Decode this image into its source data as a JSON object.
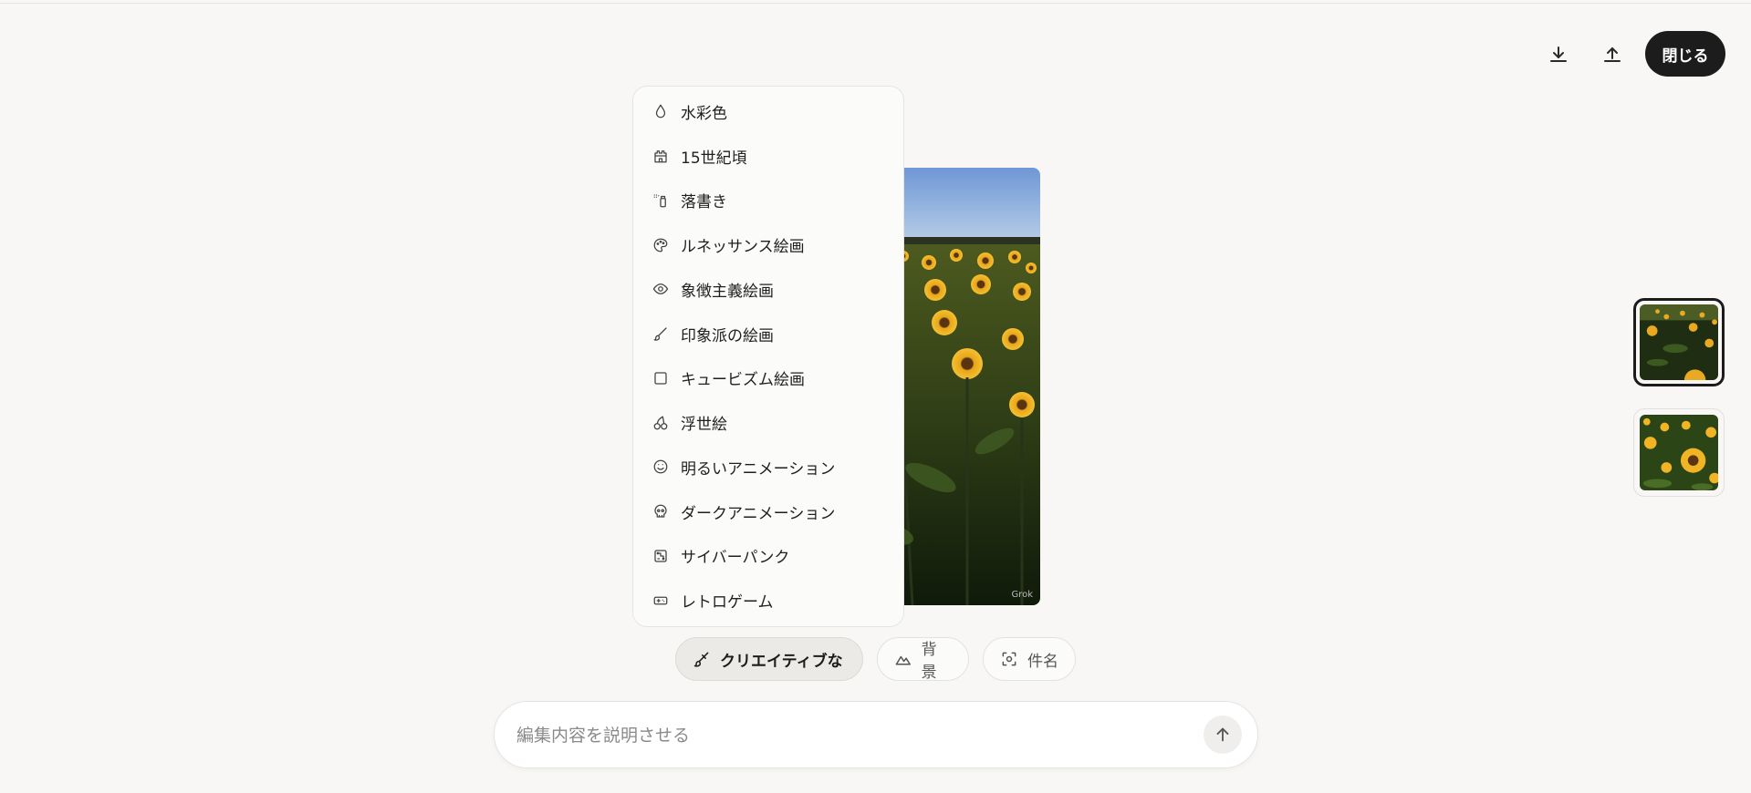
{
  "header": {
    "download_icon": "download-icon",
    "share_icon": "upload-icon",
    "close_label": "閉じる"
  },
  "style_menu": {
    "items": [
      {
        "label": "水彩色",
        "icon": "droplet-icon"
      },
      {
        "label": "15世紀頃",
        "icon": "castle-icon"
      },
      {
        "label": "落書き",
        "icon": "spray-can-icon"
      },
      {
        "label": "ルネッサンス絵画",
        "icon": "palette-icon"
      },
      {
        "label": "象徴主義絵画",
        "icon": "eye-icon"
      },
      {
        "label": "印象派の絵画",
        "icon": "brush-icon"
      },
      {
        "label": "キュービズム絵画",
        "icon": "square-icon"
      },
      {
        "label": "浮世絵",
        "icon": "cherry-icon"
      },
      {
        "label": "明るいアニメーション",
        "icon": "smile-icon"
      },
      {
        "label": "ダークアニメーション",
        "icon": "skull-icon"
      },
      {
        "label": "サイバーパンク",
        "icon": "circuit-icon"
      },
      {
        "label": "レトロゲーム",
        "icon": "gamepad-icon"
      }
    ]
  },
  "image": {
    "watermark": "Grok"
  },
  "chips": {
    "creative": {
      "label": "クリエイティブな",
      "icon": "brush-icon",
      "active": true
    },
    "background": {
      "label": "背景",
      "icon": "mountain-icon"
    },
    "subject": {
      "label": "件名",
      "icon": "focus-icon"
    }
  },
  "composer": {
    "placeholder": "編集内容を説明させる",
    "value": "",
    "send_icon": "arrow-up-icon"
  },
  "thumbnails": [
    {
      "selected": true
    },
    {
      "selected": false
    }
  ]
}
